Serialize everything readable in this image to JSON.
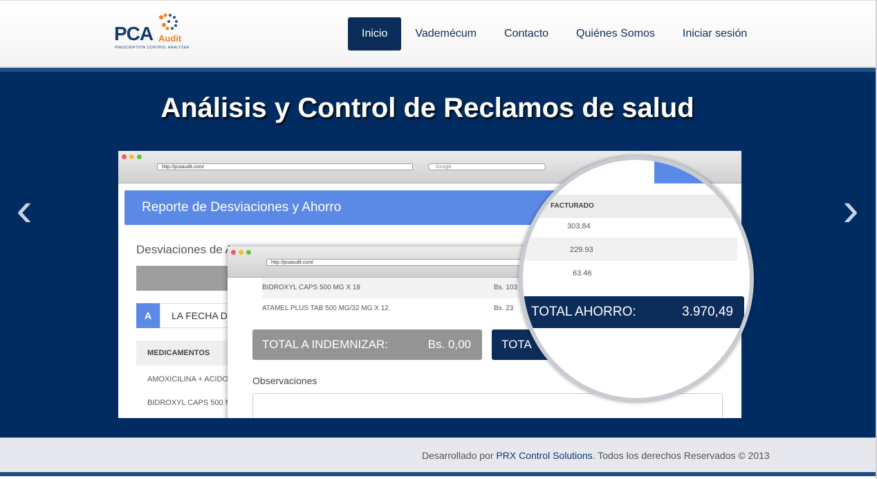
{
  "logo": {
    "brand": "PCA",
    "sub": "Audit",
    "tagline": "PRESCRIPTION CONTROL ANALYZER"
  },
  "nav": {
    "items": [
      {
        "label": "Inicio",
        "active": true
      },
      {
        "label": "Vademécum"
      },
      {
        "label": "Contacto"
      },
      {
        "label": "Quiénes Somos"
      },
      {
        "label": "Iniciar sesión"
      }
    ]
  },
  "hero": {
    "title": "Análisis y Control de Reclamos de salud",
    "prev_glyph": "‹",
    "next_glyph": "›"
  },
  "screenshot": {
    "url": "http://pcaaudit.com/",
    "search_placeholder": "Google",
    "report_title": "Reporte de Desviaciones y Ahorro",
    "section_title": "Desviaciones de A",
    "tag_letter": "A",
    "fecha_text": "LA FECHA DE",
    "med_header": "MEDICAMENTOS",
    "med_rows": [
      "AMOXICILINA + ACIDO",
      "BIDROXYL CAPS 500 M"
    ],
    "win2": {
      "url": "http://pcaaudit.com/",
      "rows": [
        {
          "name": "BIDROXYL CAPS 500 MG X 18",
          "bs": "Bs. 103"
        },
        {
          "name": "ATAMEL PLUS TAB 500 MG/32 MG X 12",
          "bs": "Bs. 23"
        }
      ],
      "indemnizar_label": "TOTAL A INDEMNIZAR:",
      "indemnizar_value": "Bs. 0,00",
      "total_label": "TOTA",
      "observaciones": "Observaciones"
    },
    "magnifier": {
      "header": "FACTURADO",
      "values": [
        "303,84",
        "229.93",
        "63.46"
      ],
      "total_label": "TOTAL AHORRO:",
      "total_value": "3.970,49"
    }
  },
  "footer": {
    "prefix": "Desarrollado por ",
    "link": "PRX Control Solutions",
    "suffix": ". Todos los derechos Reservados © 2013"
  },
  "colors": {
    "navy": "#0c2d5a",
    "hero_bg": "#002c61",
    "accent_orange": "#f08321",
    "report_blue": "#5b8ae6"
  }
}
